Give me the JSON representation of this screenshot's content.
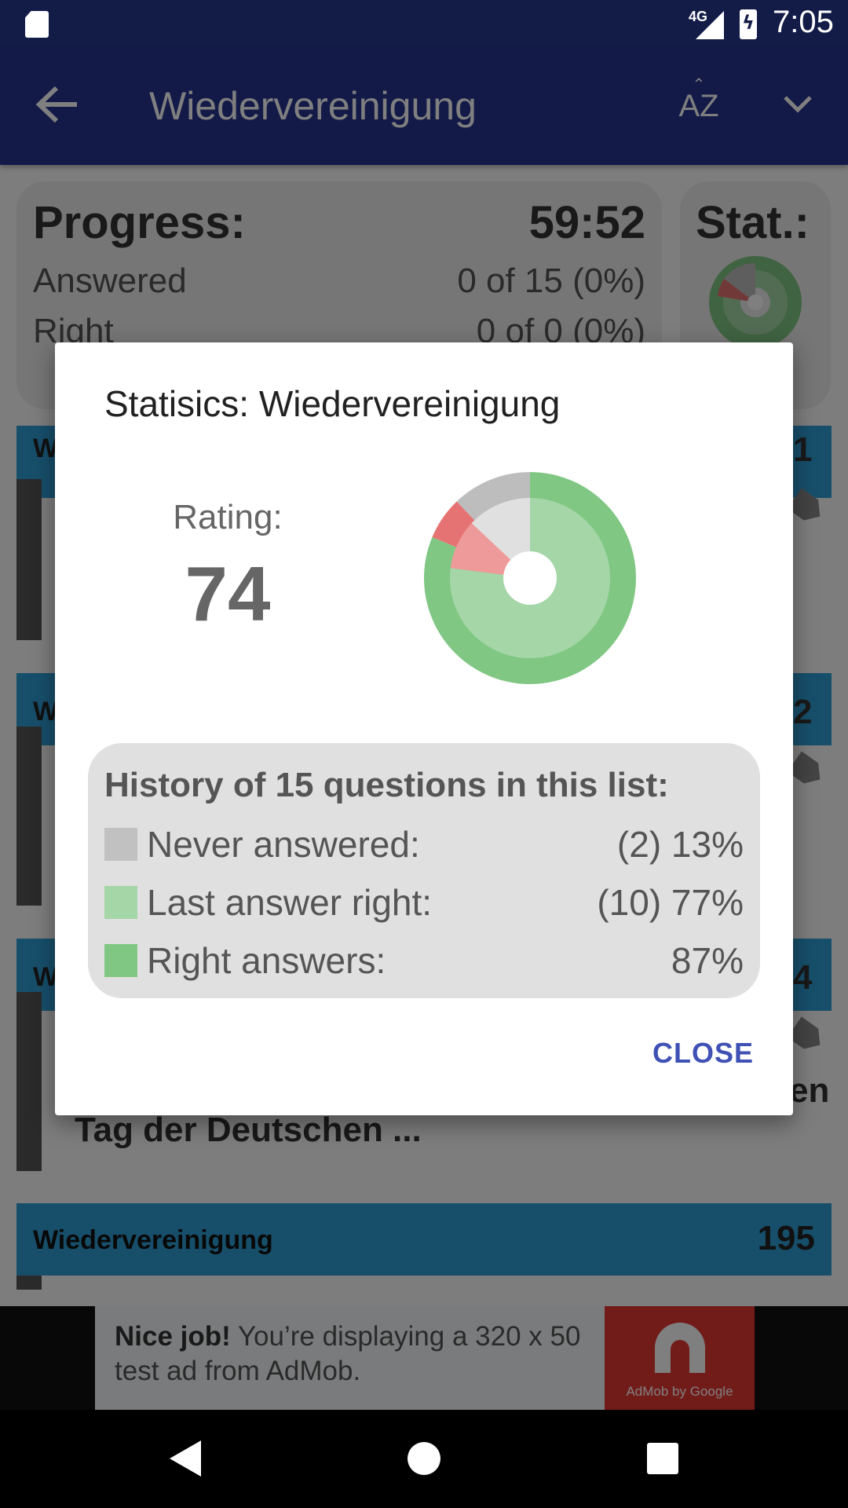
{
  "status_bar": {
    "time": "7:05",
    "network": "4G",
    "icons": [
      "sd-card-icon",
      "signal-icon",
      "battery-charging-icon"
    ]
  },
  "app_bar": {
    "title": "Wiedervereinigung",
    "sort_icon_text": "AZ",
    "icons": [
      "back-arrow-icon",
      "sort-az-icon",
      "chevron-down-icon"
    ]
  },
  "background": {
    "progress": {
      "label": "Progress:",
      "time": "59:52",
      "answered_label": "Answered",
      "answered_value": "0 of 15 (0%)",
      "right_label": "Right",
      "right_value": "0 of 0 (0%)"
    },
    "stat_label": "Stat.:",
    "questions": [
      {
        "prefix": "W",
        "number_fragment": "1"
      },
      {
        "prefix": "W",
        "number_fragment": "2"
      },
      {
        "prefix": "W",
        "number_fragment": "4",
        "text_fragment": "en",
        "question_text": "Tag der Deutschen ..."
      },
      {
        "category": "Wiedervereinigung",
        "number": "195"
      }
    ]
  },
  "ad": {
    "headline": "Nice job!",
    "body": " You’re displaying a 320 x 50 test ad from AdMob.",
    "caption": "AdMob by Google"
  },
  "dialog": {
    "title": "Statisics: Wiedervereinigung",
    "rating_label": "Rating:",
    "rating_value": "74",
    "history": {
      "title": "History of 15 questions in this list:",
      "rows": [
        {
          "label": "Never answered:",
          "value": "(2) 13%",
          "color": "#c1c1c1"
        },
        {
          "label": "Last answer right:",
          "value": "(10) 77%",
          "color": "#a5d6a7"
        },
        {
          "label": "Right answers:",
          "value": "87%",
          "color": "#81c784"
        }
      ]
    },
    "close_label": "CLOSE",
    "accent_color": "#3f51b5"
  },
  "chart_data": {
    "type": "pie",
    "rings": [
      {
        "name": "outer",
        "slices": [
          {
            "label": "Right",
            "value": 87,
            "color": "#81c784"
          },
          {
            "label": "Wrong",
            "value": 7,
            "color": "#e57373"
          },
          {
            "label": "Never answered",
            "value": 13,
            "color": "#bdbdbd"
          }
        ]
      },
      {
        "name": "inner",
        "slices": [
          {
            "label": "Last answer right",
            "value": 77,
            "color": "#a5d6a7"
          },
          {
            "label": "Last answer wrong",
            "value": 10,
            "color": "#ef9a9a"
          },
          {
            "label": "Never answered",
            "value": 13,
            "color": "#e0e0e0"
          }
        ]
      }
    ]
  }
}
